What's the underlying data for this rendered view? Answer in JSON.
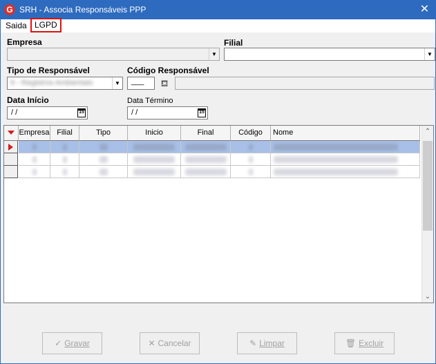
{
  "window": {
    "title": "SRH - Associa Responsáveis PPP",
    "icon_letter": "G",
    "close_glyph": "✕"
  },
  "menu": {
    "items": [
      "Saida",
      "LGPD"
    ]
  },
  "form": {
    "empresa_label": "Empresa",
    "filial_label": "Filial",
    "tipo_responsavel_label": "Tipo de Responsável",
    "tipo_responsavel_value": "9 - Registros Ambientais",
    "codigo_responsavel_label": "Código Responsável",
    "codigo_value": "___",
    "data_inicio_label": "Data Início",
    "data_inicio_value": "/ /",
    "data_termino_label": "Data Término",
    "data_termino_value": "/ /",
    "calendar_glyph": "15"
  },
  "grid": {
    "columns": [
      "Empresa",
      "Filial",
      "Tipo",
      "Inicio",
      "Final",
      "Código",
      "Nome"
    ],
    "rows": [
      {
        "selected": true,
        "cells": [
          "1",
          "1",
          "09",
          "09/03/2014",
          "31/08/2015",
          "1",
          "Responsável Registro Ambiental"
        ]
      },
      {
        "selected": false,
        "cells": [
          "1",
          "1",
          "07",
          "01/09/2015",
          "31/12/2015",
          "2",
          "Responsável Registro Ambiental"
        ]
      },
      {
        "selected": false,
        "cells": [
          "1",
          "1",
          "09",
          "01/01/2016",
          "31/12/2016",
          "3",
          "Responsável Registro Ambiental"
        ]
      }
    ]
  },
  "buttons": {
    "gravar": "Gravar",
    "cancelar": "Cancelar",
    "limpar": "Limpar",
    "excluir": "Excluir"
  },
  "colors": {
    "titlebar": "#2e6bbf",
    "selected_row": "#a8c0e8",
    "highlight_border": "#e01010",
    "row_indicator_arrow": "#d02020"
  }
}
